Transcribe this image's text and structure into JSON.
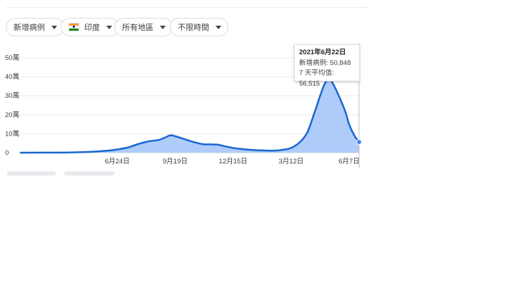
{
  "filters": {
    "metric": "新增病例",
    "country": "印度",
    "region": "所有地區",
    "time": "不限時間"
  },
  "tooltip": {
    "date": "2021年6月22日",
    "cases_label": "新增病例",
    "cases_value": "50,848",
    "avg_label": "7 天平均值",
    "avg_value": "56,515"
  },
  "colors": {
    "line": "#1967d2",
    "area": "#aecbfa",
    "grid": "#ebebeb"
  },
  "chart_data": {
    "type": "area",
    "y_ticks": [
      {
        "value": 0,
        "label": "0"
      },
      {
        "value": 100000,
        "label": "10萬"
      },
      {
        "value": 200000,
        "label": "20萬"
      },
      {
        "value": 300000,
        "label": "30萬"
      },
      {
        "value": 400000,
        "label": "40萬"
      },
      {
        "value": 500000,
        "label": "50萬"
      }
    ],
    "x_ticks": [
      {
        "date": "2020-06-24",
        "label": "6月24日"
      },
      {
        "date": "2020-09-19",
        "label": "9月19日"
      },
      {
        "date": "2020-12-15",
        "label": "12月15日"
      },
      {
        "date": "2021-03-12",
        "label": "3月12日"
      },
      {
        "date": "2021-06-07",
        "label": "6月7日"
      }
    ],
    "x_range": [
      "2020-01-30",
      "2021-06-22"
    ],
    "ylim": [
      0,
      500000
    ],
    "series": [
      {
        "x": [
          "2020-01-30",
          "2020-03-15",
          "2020-04-15",
          "2020-05-15",
          "2020-06-10",
          "2020-06-24",
          "2020-07-10",
          "2020-07-25",
          "2020-08-10",
          "2020-08-25",
          "2020-09-05",
          "2020-09-12",
          "2020-09-19",
          "2020-09-30",
          "2020-10-15",
          "2020-10-30",
          "2020-11-10",
          "2020-11-22",
          "2020-12-01",
          "2020-12-15",
          "2021-01-01",
          "2021-01-15",
          "2021-02-01",
          "2021-02-15",
          "2021-03-01",
          "2021-03-12",
          "2021-03-25",
          "2021-04-05",
          "2021-04-15",
          "2021-04-25",
          "2021-05-01",
          "2021-05-07",
          "2021-05-12",
          "2021-05-20",
          "2021-06-01",
          "2021-06-07",
          "2021-06-15",
          "2021-06-22"
        ],
        "values": [
          0,
          500,
          1500,
          4500,
          11000,
          17000,
          28000,
          45000,
          60000,
          67000,
          82000,
          92000,
          87000,
          75000,
          58000,
          45000,
          44000,
          42000,
          35000,
          25000,
          18000,
          14000,
          11500,
          11000,
          16000,
          25000,
          55000,
          105000,
          200000,
          305000,
          360000,
          390000,
          375000,
          320000,
          220000,
          150000,
          90000,
          56515
        ]
      }
    ]
  }
}
